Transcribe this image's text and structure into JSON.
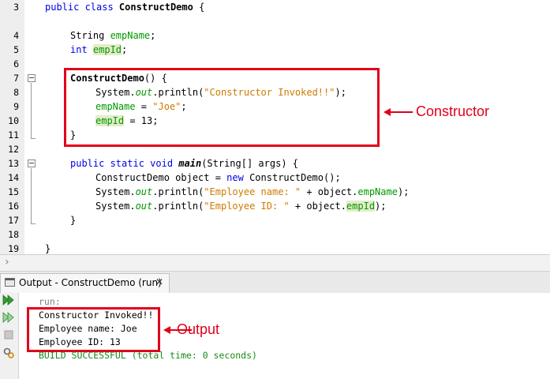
{
  "editor": {
    "line_numbers": [
      "3",
      "4",
      "5",
      "6",
      "7",
      "8",
      "9",
      "10",
      "11",
      "12",
      "13",
      "14",
      "15",
      "16",
      "17",
      "18",
      "19"
    ],
    "lines": {
      "l3": {
        "kw": "public class ",
        "name": "ConstructDemo",
        "rest": " {"
      },
      "l5": {
        "type": "String ",
        "field": "empName",
        "end": ";"
      },
      "l6": {
        "kw": "int ",
        "field": "empId",
        "end": ";"
      },
      "l8": {
        "name": "ConstructDemo",
        "rest": "() {"
      },
      "l9": {
        "a": "System.",
        "b": "out",
        "c": ".println(",
        "str": "\"Constructor Invoked!!\"",
        "d": ");"
      },
      "l10": {
        "field": "empName",
        "op": " = ",
        "str": "\"Joe\"",
        "end": ";"
      },
      "l11": {
        "field": "empId",
        "rest": " = 13;"
      },
      "l12": {
        "text": "}"
      },
      "l14": {
        "kw": "public static void ",
        "name": "main",
        "rest": "(String[] args) {"
      },
      "l15": {
        "a": "ConstructDemo object = ",
        "kw": "new",
        "b": " ConstructDemo();"
      },
      "l16": {
        "a": "System.",
        "b": "out",
        "c": ".println(",
        "str": "\"Employee name: \"",
        "d": " + object.",
        "field": "empName",
        "e": ");"
      },
      "l17": {
        "a": "System.",
        "b": "out",
        "c": ".println(",
        "str": "\"Employee ID: \"",
        "d": " + object.",
        "field": "empId",
        "e": ");"
      },
      "l18": {
        "text": "}"
      },
      "l20": {
        "text": "}"
      }
    }
  },
  "annotations": {
    "constructor_label": "Constructor",
    "output_label": "Output"
  },
  "output_panel": {
    "tab_label": "Output - ConstructDemo (run)",
    "close_glyph": "✕",
    "lines": {
      "run": "run:",
      "o1": "Constructor Invoked!!",
      "o2": "Employee name: Joe",
      "o3": "Employee ID: 13",
      "build": "BUILD SUCCESSFUL (total time: 0 seconds)"
    }
  },
  "colors": {
    "keyword": "#0000e6",
    "string": "#ce7b00",
    "field": "#009900",
    "annotation": "#e0001b",
    "build_success": "#1a8a1a",
    "run_prefix": "#808080"
  },
  "icons": [
    "fold-collapse-icon",
    "nav-chevron-icon",
    "output-window-icon",
    "close-icon",
    "rerun-icon",
    "rerun-with-options-icon",
    "stop-icon",
    "settings-icon"
  ]
}
